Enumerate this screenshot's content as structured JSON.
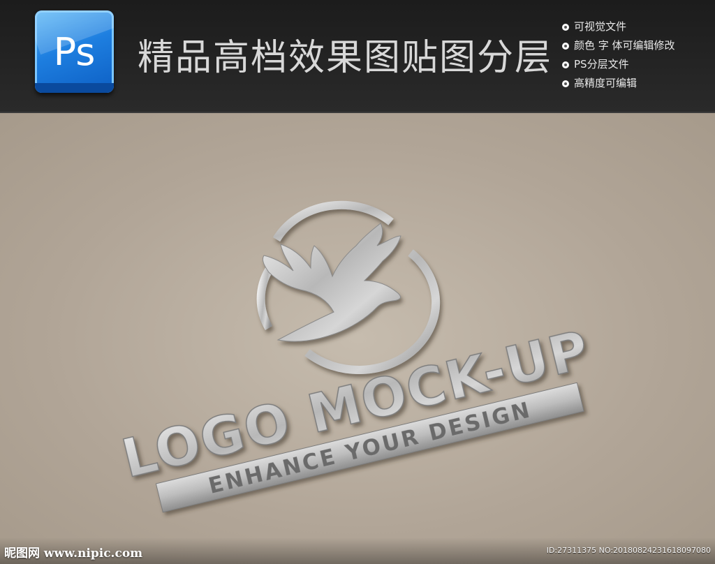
{
  "header": {
    "app_icon_text": "Ps",
    "title": "精品高档效果图贴图分层",
    "features": [
      "可视觉文件",
      "颜色 字 体可编辑修改",
      "PS分层文件",
      "高精度可编辑"
    ]
  },
  "mockup": {
    "brand_text": "LOGO MOCK-UP",
    "tagline": "ENHANCE YOUR DESIGN",
    "emblem": "dove-in-circle"
  },
  "footer": {
    "site": "昵图网 www.nipic.com",
    "id_text": "ID:27311375 NO:20180824231618097080"
  },
  "colors": {
    "header_bg": "#1f1f1f",
    "paper": "#b3a798",
    "metal": "#c9c9c9",
    "ps_blue": "#1e7fe0"
  }
}
